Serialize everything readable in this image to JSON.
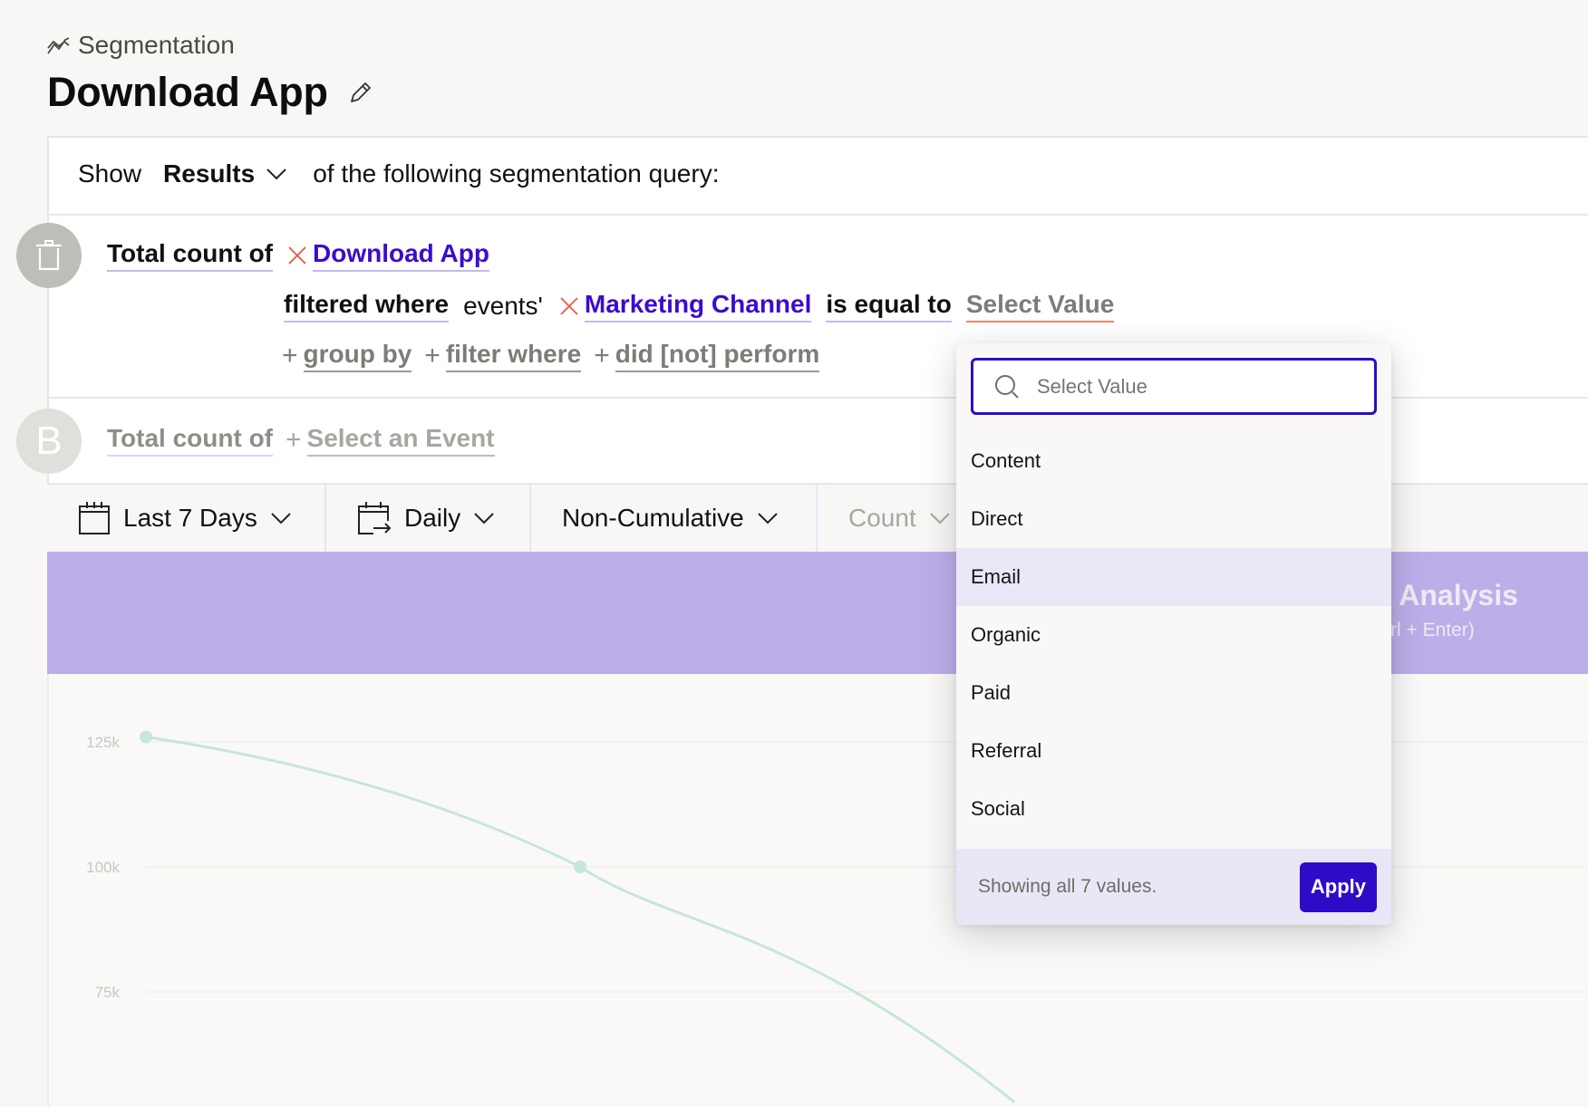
{
  "breadcrumb": {
    "icon": "segmentation-chart-icon",
    "label": "Segmentation"
  },
  "page": {
    "title": "Download App",
    "edit_icon": "pencil-icon"
  },
  "query": {
    "show_label": "Show",
    "show_value": "Results",
    "show_suffix": "of the following segmentation query:",
    "row_a": {
      "badge_icon": "trash-icon",
      "aggregation": "Total count of",
      "event": "Download App",
      "filter_prefix": "filtered where",
      "filter_scope": "events'",
      "filter_property": "Marketing Channel",
      "filter_operator": "is equal to",
      "filter_value": "Select Value",
      "actions": [
        "group by",
        "filter where",
        "did [not] perform"
      ]
    },
    "row_b": {
      "badge": "B",
      "aggregation": "Total count of",
      "event_placeholder": "Select an Event"
    }
  },
  "toolbar": {
    "date_range": "Last 7 Days",
    "interval": "Daily",
    "cumulative": "Non-Cumulative",
    "metric": "Count"
  },
  "banner": {
    "title_partial": "n Analysis",
    "hint_partial": "rl + Enter)"
  },
  "dropdown": {
    "search_placeholder": "Select Value",
    "options": [
      "Content",
      "Direct",
      "Email",
      "Organic",
      "Paid",
      "Referral",
      "Social"
    ],
    "highlighted": "Email",
    "footer_text": "Showing all 7 values.",
    "apply_label": "Apply"
  },
  "colors": {
    "accent": "#2e0bc7",
    "banner": "#bcaee9",
    "remove_x": "#e4583e",
    "line": "#c6e6da"
  },
  "chart_data": {
    "type": "line",
    "title": "",
    "xlabel": "",
    "ylabel": "",
    "y_ticks": [
      "125k",
      "100k",
      "75k"
    ],
    "y_tick_values": [
      125000,
      100000,
      75000
    ],
    "series": [
      {
        "name": "Total count of Download App",
        "values": [
          126000,
          100000,
          53000
        ]
      }
    ],
    "grid": true
  }
}
